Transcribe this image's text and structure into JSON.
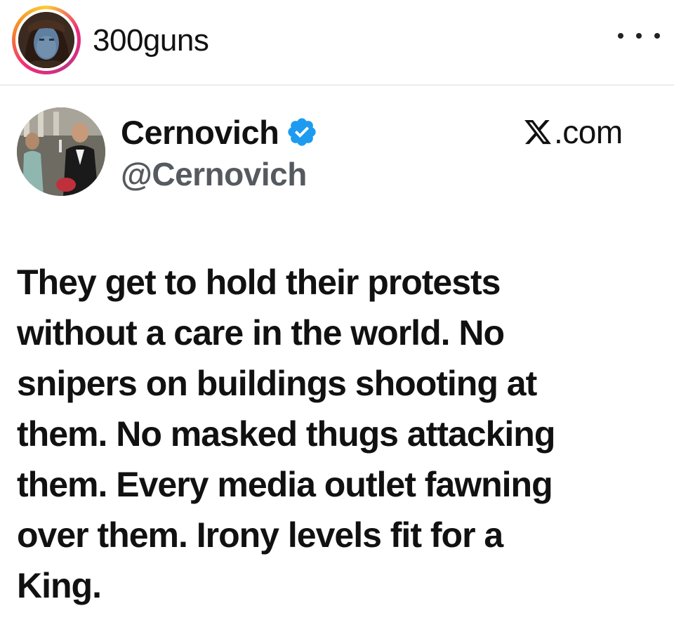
{
  "post_header": {
    "username": "300guns",
    "avatar_icon": "user-avatar-photo",
    "more_icon": "more-horizontal-icon"
  },
  "tweet": {
    "display_name": "Cernovich",
    "handle": "@Cernovich",
    "verified_color": "#1d9bf0",
    "source": ".com",
    "source_icon": "x-logo-icon",
    "text": "They get to hold their protests\nwithout a care in the world. No\nsnipers on buildings shooting at\nthem. No masked thugs attacking\nthem. Every media outlet fawning\nover them. Irony levels fit for a\nKing."
  }
}
